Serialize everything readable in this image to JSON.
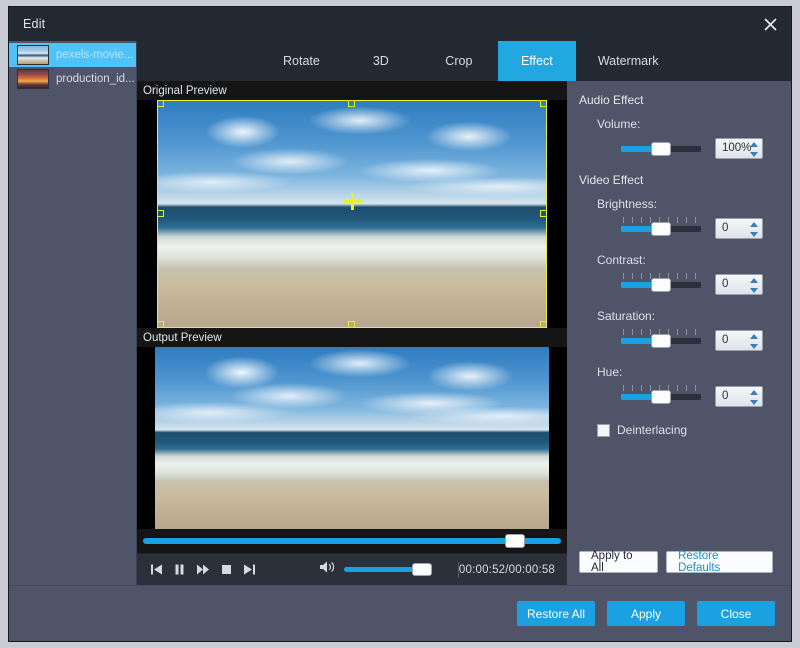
{
  "window": {
    "title": "Edit",
    "close_icon": "close-icon"
  },
  "sidebar": {
    "files": [
      {
        "name": "pexels-movie...",
        "selected": true
      },
      {
        "name": "production_id...",
        "selected": false
      }
    ]
  },
  "tabs": [
    {
      "label": "Rotate",
      "active": false
    },
    {
      "label": "3D",
      "active": false
    },
    {
      "label": "Crop",
      "active": false
    },
    {
      "label": "Effect",
      "active": true
    },
    {
      "label": "Watermark",
      "active": false
    }
  ],
  "preview": {
    "original_label": "Original Preview",
    "output_label": "Output Preview",
    "seek_percent": 89
  },
  "transport": {
    "buttons": [
      {
        "icon": "previous-icon"
      },
      {
        "icon": "pause-icon"
      },
      {
        "icon": "fast-forward-icon"
      },
      {
        "icon": "stop-icon"
      },
      {
        "icon": "next-icon"
      }
    ],
    "volume_icon": "speaker-icon",
    "volume_percent": 100,
    "time": "00:00:52/00:00:58"
  },
  "settings": {
    "audio_group": "Audio Effect",
    "video_group": "Video Effect",
    "volume": {
      "label": "Volume:",
      "value": "100%",
      "slider_percent": 50
    },
    "brightness": {
      "label": "Brightness:",
      "value": "0",
      "slider_percent": 50
    },
    "contrast": {
      "label": "Contrast:",
      "value": "0",
      "slider_percent": 50
    },
    "saturation": {
      "label": "Saturation:",
      "value": "0",
      "slider_percent": 50
    },
    "hue": {
      "label": "Hue:",
      "value": "0",
      "slider_percent": 50
    },
    "deinterlacing": {
      "label": "Deinterlacing",
      "checked": false
    },
    "apply_to_all": "Apply to All",
    "restore_defaults": "Restore Defaults"
  },
  "footer": {
    "restore_all": "Restore All",
    "apply": "Apply",
    "close": "Close"
  },
  "colors": {
    "accent": "#1ba1e2",
    "panel": "#4f5468",
    "titlebar": "#242a33",
    "crop_outline": "#e9ef2c"
  }
}
